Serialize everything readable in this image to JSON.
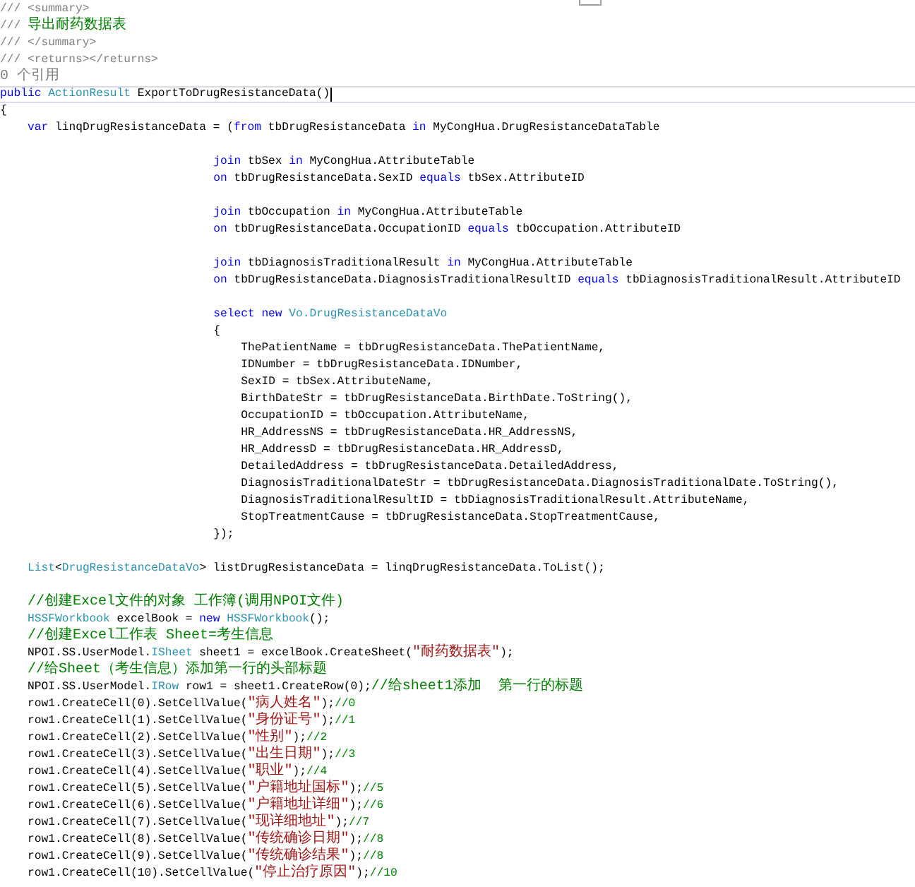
{
  "editor": {
    "lines": [
      {
        "current": false,
        "tokens": [
          {
            "text": "/// <summary>",
            "kind": "doc"
          }
        ]
      },
      {
        "current": false,
        "tokens": [
          {
            "text": "/// ",
            "kind": "doc"
          },
          {
            "text": "导出耐药数据表",
            "kind": "comment"
          }
        ]
      },
      {
        "current": false,
        "tokens": [
          {
            "text": "/// </summary>",
            "kind": "doc"
          }
        ]
      },
      {
        "current": false,
        "tokens": [
          {
            "text": "/// <returns></returns>",
            "kind": "doc"
          }
        ]
      },
      {
        "current": false,
        "tokens": [
          {
            "text": "0 个引用",
            "kind": "ref"
          }
        ]
      },
      {
        "current": true,
        "tokens": [
          {
            "text": "public",
            "kind": "keyword"
          },
          {
            "text": " ActionResult",
            "kind": "type"
          },
          {
            "text": " ExportToDrugResistanceData()",
            "kind": "plain"
          }
        ]
      },
      {
        "current": false,
        "tokens": [
          {
            "text": "{",
            "kind": "plain"
          }
        ],
        "children": [
          {
            "current": false,
            "tokens": [
              {
                "text": "var",
                "kind": "keyword"
              },
              {
                "text": " linqDrugResistanceData = (",
                "kind": "plain"
              },
              {
                "text": "from",
                "kind": "keyword"
              },
              {
                "text": " tbDrugResistanceData ",
                "kind": "plain"
              },
              {
                "text": "in",
                "kind": "keyword"
              },
              {
                "text": " MyCongHua.DrugResistanceDataTable",
                "kind": "plain"
              }
            ],
            "children": [
              {
                "current": false
              },
              {
                "current": false,
                "tokens": [
                  {
                    "text": "join",
                    "kind": "keyword"
                  },
                  {
                    "text": " tbSex ",
                    "kind": "plain"
                  },
                  {
                    "text": "in",
                    "kind": "keyword"
                  },
                  {
                    "text": " MyCongHua.AttributeTable",
                    "kind": "plain"
                  }
                ]
              },
              {
                "current": false,
                "tokens": [
                  {
                    "text": "on",
                    "kind": "keyword"
                  },
                  {
                    "text": " tbDrugResistanceData.SexID ",
                    "kind": "plain"
                  },
                  {
                    "text": "equals",
                    "kind": "keyword"
                  },
                  {
                    "text": " tbSex.AttributeID",
                    "kind": "plain"
                  }
                ]
              },
              {
                "current": false
              },
              {
                "current": false,
                "tokens": [
                  {
                    "text": "join",
                    "kind": "keyword"
                  },
                  {
                    "text": " tbOccupation ",
                    "kind": "plain"
                  },
                  {
                    "text": "in",
                    "kind": "keyword"
                  },
                  {
                    "text": " MyCongHua.AttributeTable",
                    "kind": "plain"
                  }
                ]
              },
              {
                "current": false,
                "tokens": [
                  {
                    "text": "on",
                    "kind": "keyword"
                  },
                  {
                    "text": " tbDrugResistanceData.OccupationID ",
                    "kind": "plain"
                  },
                  {
                    "text": "equals",
                    "kind": "keyword"
                  },
                  {
                    "text": " tbOccupation.AttributeID",
                    "kind": "plain"
                  }
                ]
              },
              {
                "current": false
              },
              {
                "current": false,
                "tokens": [
                  {
                    "text": "join",
                    "kind": "keyword"
                  },
                  {
                    "text": " tbDiagnosisTraditionalResult ",
                    "kind": "plain"
                  },
                  {
                    "text": "in",
                    "kind": "keyword"
                  },
                  {
                    "text": " MyCongHua.AttributeTable",
                    "kind": "plain"
                  }
                ]
              },
              {
                "current": false,
                "tokens": [
                  {
                    "text": "on",
                    "kind": "keyword"
                  },
                  {
                    "text": " tbDrugResistanceData.DiagnosisTraditionalResultID ",
                    "kind": "plain"
                  },
                  {
                    "text": "equals",
                    "kind": "keyword"
                  },
                  {
                    "text": " tbDiagnosisTraditionalResult.AttributeID",
                    "kind": "plain"
                  }
                ]
              },
              {
                "current": false
              },
              {
                "current": false,
                "tokens": [
                  {
                    "text": "select",
                    "kind": "keyword"
                  },
                  {
                    "text": " new",
                    "kind": "keyword"
                  },
                  {
                    "text": " Vo.DrugResistanceDataVo",
                    "kind": "type"
                  }
                ]
              },
              {
                "current": false,
                "tokens": [
                  {
                    "text": "{",
                    "kind": "plain"
                  }
                ],
                "children": [
                  {
                    "current": false,
                    "tokens": [
                      {
                        "text": "ThePatientName = tbDrugResistanceData.ThePatientName,",
                        "kind": "plain"
                      }
                    ]
                  },
                  {
                    "current": false,
                    "tokens": [
                      {
                        "text": "IDNumber = tbDrugResistanceData.IDNumber,",
                        "kind": "plain"
                      }
                    ]
                  },
                  {
                    "current": false,
                    "tokens": [
                      {
                        "text": "SexID = tbSex.AttributeName,",
                        "kind": "plain"
                      }
                    ]
                  },
                  {
                    "current": false,
                    "tokens": [
                      {
                        "text": "BirthDateStr = tbDrugResistanceData.BirthDate.ToString(),",
                        "kind": "plain"
                      }
                    ]
                  },
                  {
                    "current": false,
                    "tokens": [
                      {
                        "text": "OccupationID = tbOccupation.AttributeName,",
                        "kind": "plain"
                      }
                    ]
                  },
                  {
                    "current": false,
                    "tokens": [
                      {
                        "text": "HR_AddressNS = tbDrugResistanceData.HR_AddressNS,",
                        "kind": "plain"
                      }
                    ]
                  },
                  {
                    "current": false,
                    "tokens": [
                      {
                        "text": "HR_AddressD = tbDrugResistanceData.HR_AddressD,",
                        "kind": "plain"
                      }
                    ]
                  },
                  {
                    "current": false,
                    "tokens": [
                      {
                        "text": "DetailedAddress = tbDrugResistanceData.DetailedAddress,",
                        "kind": "plain"
                      }
                    ]
                  },
                  {
                    "current": false,
                    "tokens": [
                      {
                        "text": "DiagnosisTraditionalDateStr = tbDrugResistanceData.DiagnosisTraditionalDate.ToString(),",
                        "kind": "plain"
                      }
                    ]
                  },
                  {
                    "current": false,
                    "tokens": [
                      {
                        "text": "DiagnosisTraditionalResultID = tbDiagnosisTraditionalResult.AttributeName,",
                        "kind": "plain"
                      }
                    ]
                  },
                  {
                    "current": false,
                    "tokens": [
                      {
                        "text": "StopTreatmentCause = tbDrugResistanceData.StopTreatmentCause,",
                        "kind": "plain"
                      }
                    ]
                  }
                ]
              },
              {
                "current": false,
                "tokens": [
                  {
                    "text": "});",
                    "kind": "plain"
                  }
                ]
              }
            ]
          },
          {
            "current": false
          },
          {
            "current": false,
            "tokens": [
              {
                "text": "List",
                "kind": "type"
              },
              {
                "text": "<",
                "kind": "plain"
              },
              {
                "text": "DrugResistanceDataVo",
                "kind": "type"
              },
              {
                "text": "> listDrugResistanceData = linqDrugResistanceData.ToList();",
                "kind": "plain"
              }
            ]
          },
          {
            "current": false
          },
          {
            "current": false,
            "tokens": [
              {
                "text": "//创建Excel文件的对象 工作簿(调用NPOI文件)",
                "kind": "comment"
              }
            ]
          },
          {
            "current": false,
            "tokens": [
              {
                "text": "HSSFWorkbook",
                "kind": "type"
              },
              {
                "text": " excelBook = ",
                "kind": "plain"
              },
              {
                "text": "new",
                "kind": "keyword"
              },
              {
                "text": " HSSFWorkbook",
                "kind": "type"
              },
              {
                "text": "();",
                "kind": "plain"
              }
            ]
          },
          {
            "current": false,
            "tokens": [
              {
                "text": "//创建Excel工作表 Sheet=考生信息",
                "kind": "comment"
              }
            ]
          },
          {
            "current": false,
            "tokens": [
              {
                "text": "NPOI.SS.UserModel.",
                "kind": "plain"
              },
              {
                "text": "ISheet",
                "kind": "type"
              },
              {
                "text": " sheet1 = excelBook.CreateSheet(",
                "kind": "plain"
              },
              {
                "text": "\"耐药数据表\"",
                "kind": "string"
              },
              {
                "text": ");",
                "kind": "plain"
              }
            ]
          },
          {
            "current": false,
            "tokens": [
              {
                "text": "//给Sheet（考生信息）添加第一行的头部标题",
                "kind": "comment"
              }
            ]
          },
          {
            "current": false,
            "tokens": [
              {
                "text": "NPOI.SS.UserModel.",
                "kind": "plain"
              },
              {
                "text": "IRow",
                "kind": "type"
              },
              {
                "text": " row1 = sheet1.CreateRow(0);",
                "kind": "plain"
              },
              {
                "text": "//给sheet1添加  第一行的标题",
                "kind": "comment"
              }
            ]
          },
          {
            "current": false,
            "tokens": [
              {
                "text": "row1.CreateCell(0).SetCellValue(",
                "kind": "plain"
              },
              {
                "text": "\"病人姓名\"",
                "kind": "string"
              },
              {
                "text": ");",
                "kind": "plain"
              },
              {
                "text": "//0",
                "kind": "comment"
              }
            ]
          },
          {
            "current": false,
            "tokens": [
              {
                "text": "row1.CreateCell(1).SetCellValue(",
                "kind": "plain"
              },
              {
                "text": "\"身份证号\"",
                "kind": "string"
              },
              {
                "text": ");",
                "kind": "plain"
              },
              {
                "text": "//1",
                "kind": "comment"
              }
            ]
          },
          {
            "current": false,
            "tokens": [
              {
                "text": "row1.CreateCell(2).SetCellValue(",
                "kind": "plain"
              },
              {
                "text": "\"性别\"",
                "kind": "string"
              },
              {
                "text": ");",
                "kind": "plain"
              },
              {
                "text": "//2",
                "kind": "comment"
              }
            ]
          },
          {
            "current": false,
            "tokens": [
              {
                "text": "row1.CreateCell(3).SetCellValue(",
                "kind": "plain"
              },
              {
                "text": "\"出生日期\"",
                "kind": "string"
              },
              {
                "text": ");",
                "kind": "plain"
              },
              {
                "text": "//3",
                "kind": "comment"
              }
            ]
          },
          {
            "current": false,
            "tokens": [
              {
                "text": "row1.CreateCell(4).SetCellValue(",
                "kind": "plain"
              },
              {
                "text": "\"职业\"",
                "kind": "string"
              },
              {
                "text": ");",
                "kind": "plain"
              },
              {
                "text": "//4",
                "kind": "comment"
              }
            ]
          },
          {
            "current": false,
            "tokens": [
              {
                "text": "row1.CreateCell(5).SetCellValue(",
                "kind": "plain"
              },
              {
                "text": "\"户籍地址国标\"",
                "kind": "string"
              },
              {
                "text": ");",
                "kind": "plain"
              },
              {
                "text": "//5",
                "kind": "comment"
              }
            ]
          },
          {
            "current": false,
            "tokens": [
              {
                "text": "row1.CreateCell(6).SetCellValue(",
                "kind": "plain"
              },
              {
                "text": "\"户籍地址详细\"",
                "kind": "string"
              },
              {
                "text": ");",
                "kind": "plain"
              },
              {
                "text": "//6",
                "kind": "comment"
              }
            ]
          },
          {
            "current": false,
            "tokens": [
              {
                "text": "row1.CreateCell(7).SetCellValue(",
                "kind": "plain"
              },
              {
                "text": "\"现详细地址\"",
                "kind": "string"
              },
              {
                "text": ");",
                "kind": "plain"
              },
              {
                "text": "//7",
                "kind": "comment"
              }
            ]
          },
          {
            "current": false,
            "tokens": [
              {
                "text": "row1.CreateCell(8).SetCellValue(",
                "kind": "plain"
              },
              {
                "text": "\"传统确诊日期\"",
                "kind": "string"
              },
              {
                "text": ");",
                "kind": "plain"
              },
              {
                "text": "//8",
                "kind": "comment"
              }
            ]
          },
          {
            "current": false,
            "tokens": [
              {
                "text": "row1.CreateCell(9).SetCellValue(",
                "kind": "plain"
              },
              {
                "text": "\"传统确诊结果\"",
                "kind": "string"
              },
              {
                "text": ");",
                "kind": "plain"
              },
              {
                "text": "//8",
                "kind": "comment"
              }
            ]
          },
          {
            "current": false,
            "tokens": [
              {
                "text": "row1.CreateCell(10).SetCellValue(",
                "kind": "plain"
              },
              {
                "text": "\"停止治疗原因\"",
                "kind": "string"
              },
              {
                "text": ");",
                "kind": "plain"
              },
              {
                "text": "//10",
                "kind": "comment"
              }
            ]
          }
        ]
      }
    ]
  }
}
